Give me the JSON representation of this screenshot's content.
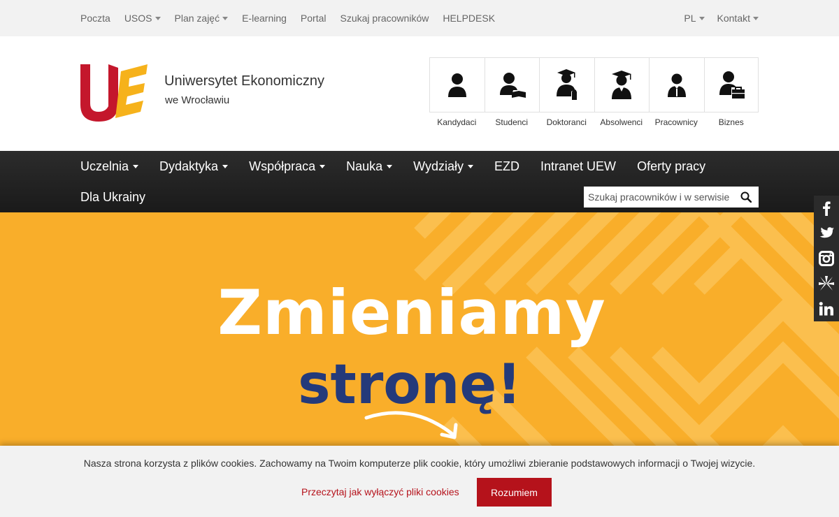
{
  "topbar": {
    "links": [
      {
        "label": "Poczta",
        "dropdown": false
      },
      {
        "label": "USOS",
        "dropdown": true
      },
      {
        "label": "Plan zajęć",
        "dropdown": true
      },
      {
        "label": "E-learning",
        "dropdown": false
      },
      {
        "label": "Portal",
        "dropdown": false
      },
      {
        "label": "Szukaj pracowników",
        "dropdown": false
      },
      {
        "label": "HELPDESK",
        "dropdown": false
      }
    ],
    "language": "PL",
    "contact": "Kontakt"
  },
  "brand": {
    "name": "Uniwersytet Ekonomiczny",
    "subname": "we Wrocławiu",
    "colors": {
      "u": "#c4172c",
      "e": "#f6b21b"
    }
  },
  "groups": [
    {
      "label": "Kandydaci",
      "icon": "candidate-icon"
    },
    {
      "label": "Studenci",
      "icon": "student-icon"
    },
    {
      "label": "Doktoranci",
      "icon": "doctoral-icon"
    },
    {
      "label": "Absolwenci",
      "icon": "graduate-icon"
    },
    {
      "label": "Pracownicy",
      "icon": "employee-icon"
    },
    {
      "label": "Biznes",
      "icon": "business-icon"
    }
  ],
  "nav": {
    "items": [
      {
        "label": "Uczelnia",
        "dropdown": true
      },
      {
        "label": "Dydaktyka",
        "dropdown": true
      },
      {
        "label": "Współpraca",
        "dropdown": true
      },
      {
        "label": "Nauka",
        "dropdown": true
      },
      {
        "label": "Wydziały",
        "dropdown": true
      },
      {
        "label": "EZD",
        "dropdown": false
      },
      {
        "label": "Intranet UEW",
        "dropdown": false
      },
      {
        "label": "Oferty pracy",
        "dropdown": false
      }
    ],
    "second_row": "Dla Ukrainy",
    "search_placeholder": "Szukaj pracowników i w serwisie"
  },
  "hero": {
    "title": "Zmieniamy",
    "subtitle": "stronę!",
    "background": "#f9ae2a",
    "subtitle_color": "#243a7a"
  },
  "social": [
    "facebook-icon",
    "twitter-icon",
    "instagram-icon",
    "starflower-icon",
    "linkedin-icon"
  ],
  "cookie": {
    "text": "Nasza strona korzysta z plików cookies. Zachowamy na Twoim komputerze plik cookie, który umożliwi zbieranie podstawowych informacji o Twojej wizycie.",
    "link": "Przeczytaj jak wyłączyć pliki cookies",
    "button": "Rozumiem",
    "accent": "#b5121b"
  }
}
